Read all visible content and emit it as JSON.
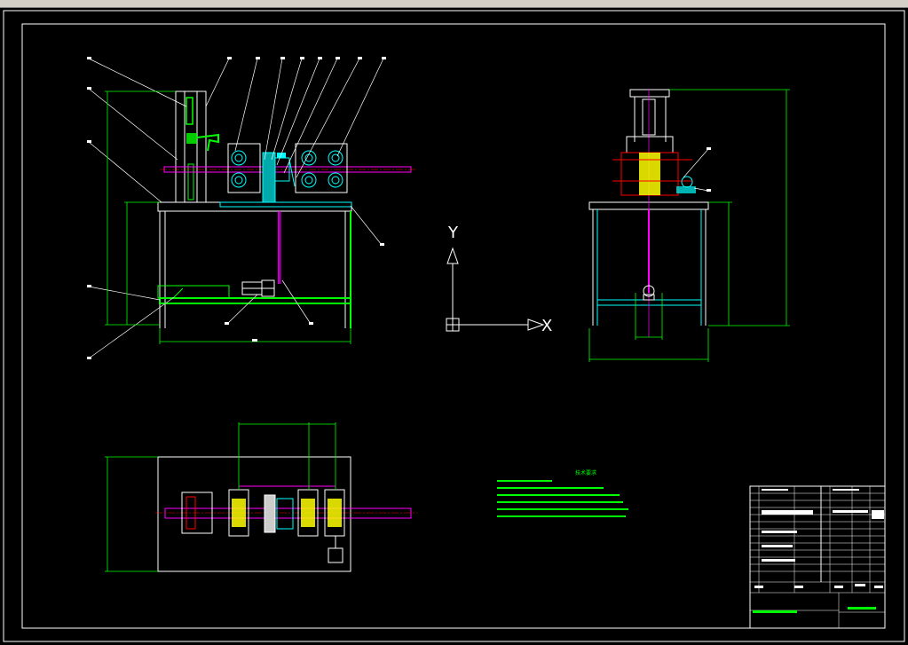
{
  "window": {
    "title_bar_color": "#d4d0c8"
  },
  "colors": {
    "background": "#000000",
    "frame": "#ffffff",
    "outline": "#ffffff",
    "dimension": "#00ff00",
    "hidden": "#00ffff",
    "shaft": "#ff00ff",
    "center": "#ff0000",
    "roller": "#ffff00",
    "part": "#00ffff"
  },
  "ucs": {
    "y_label": "Y",
    "x_label": "X"
  },
  "views": [
    "front-view",
    "side-view",
    "top-view"
  ],
  "tech_requirements": {
    "title": "技术要求",
    "lines": [
      "1.",
      "2.",
      "3.",
      "4.",
      "5."
    ]
  },
  "title_block": {
    "present": true
  }
}
